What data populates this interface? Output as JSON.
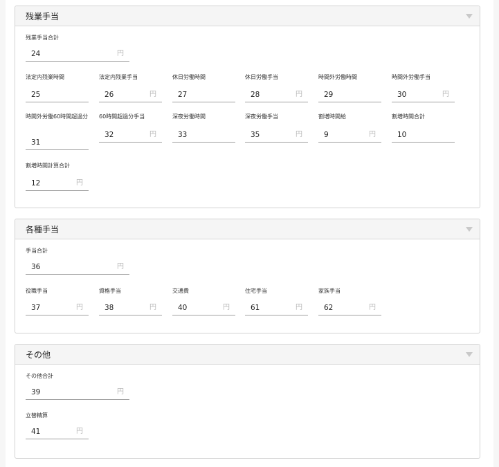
{
  "sections": {
    "overtime": {
      "title": "残業手当",
      "total": {
        "label": "残業手当合計",
        "value": "24",
        "unit": "円"
      },
      "row1": [
        {
          "label": "法定内残業時間",
          "value": "25",
          "unit": ""
        },
        {
          "label": "法定内残業手当",
          "value": "26",
          "unit": "円"
        },
        {
          "label": "休日労働時間",
          "value": "27",
          "unit": ""
        },
        {
          "label": "休日労働手当",
          "value": "28",
          "unit": "円"
        },
        {
          "label": "時間外労働時間",
          "value": "29",
          "unit": ""
        },
        {
          "label": "時間外労働手当",
          "value": "30",
          "unit": "円"
        }
      ],
      "row2": [
        {
          "label": "時間外労働60時間超過分",
          "value": "31",
          "unit": ""
        },
        {
          "label": "60時間超過分手当",
          "value": "32",
          "unit": "円"
        },
        {
          "label": "深夜労働時間",
          "value": "33",
          "unit": ""
        },
        {
          "label": "深夜労働手当",
          "value": "35",
          "unit": "円"
        },
        {
          "label": "割増時間給",
          "value": "9",
          "unit": "円"
        },
        {
          "label": "割増時間合計",
          "value": "10",
          "unit": ""
        }
      ],
      "extra": {
        "label": "割増時間計算合計",
        "value": "12",
        "unit": "円"
      }
    },
    "allowances": {
      "title": "各種手当",
      "total": {
        "label": "手当合計",
        "value": "36",
        "unit": "円"
      },
      "row1": [
        {
          "label": "役職手当",
          "value": "37",
          "unit": "円"
        },
        {
          "label": "資格手当",
          "value": "38",
          "unit": "円"
        },
        {
          "label": "交通費",
          "value": "40",
          "unit": "円"
        },
        {
          "label": "住宅手当",
          "value": "61",
          "unit": "円"
        },
        {
          "label": "家族手当",
          "value": "62",
          "unit": "円"
        }
      ]
    },
    "other": {
      "title": "その他",
      "total": {
        "label": "その他合計",
        "value": "39",
        "unit": "円"
      },
      "reimbursement": {
        "label": "立替精算",
        "value": "41",
        "unit": "円"
      }
    }
  }
}
